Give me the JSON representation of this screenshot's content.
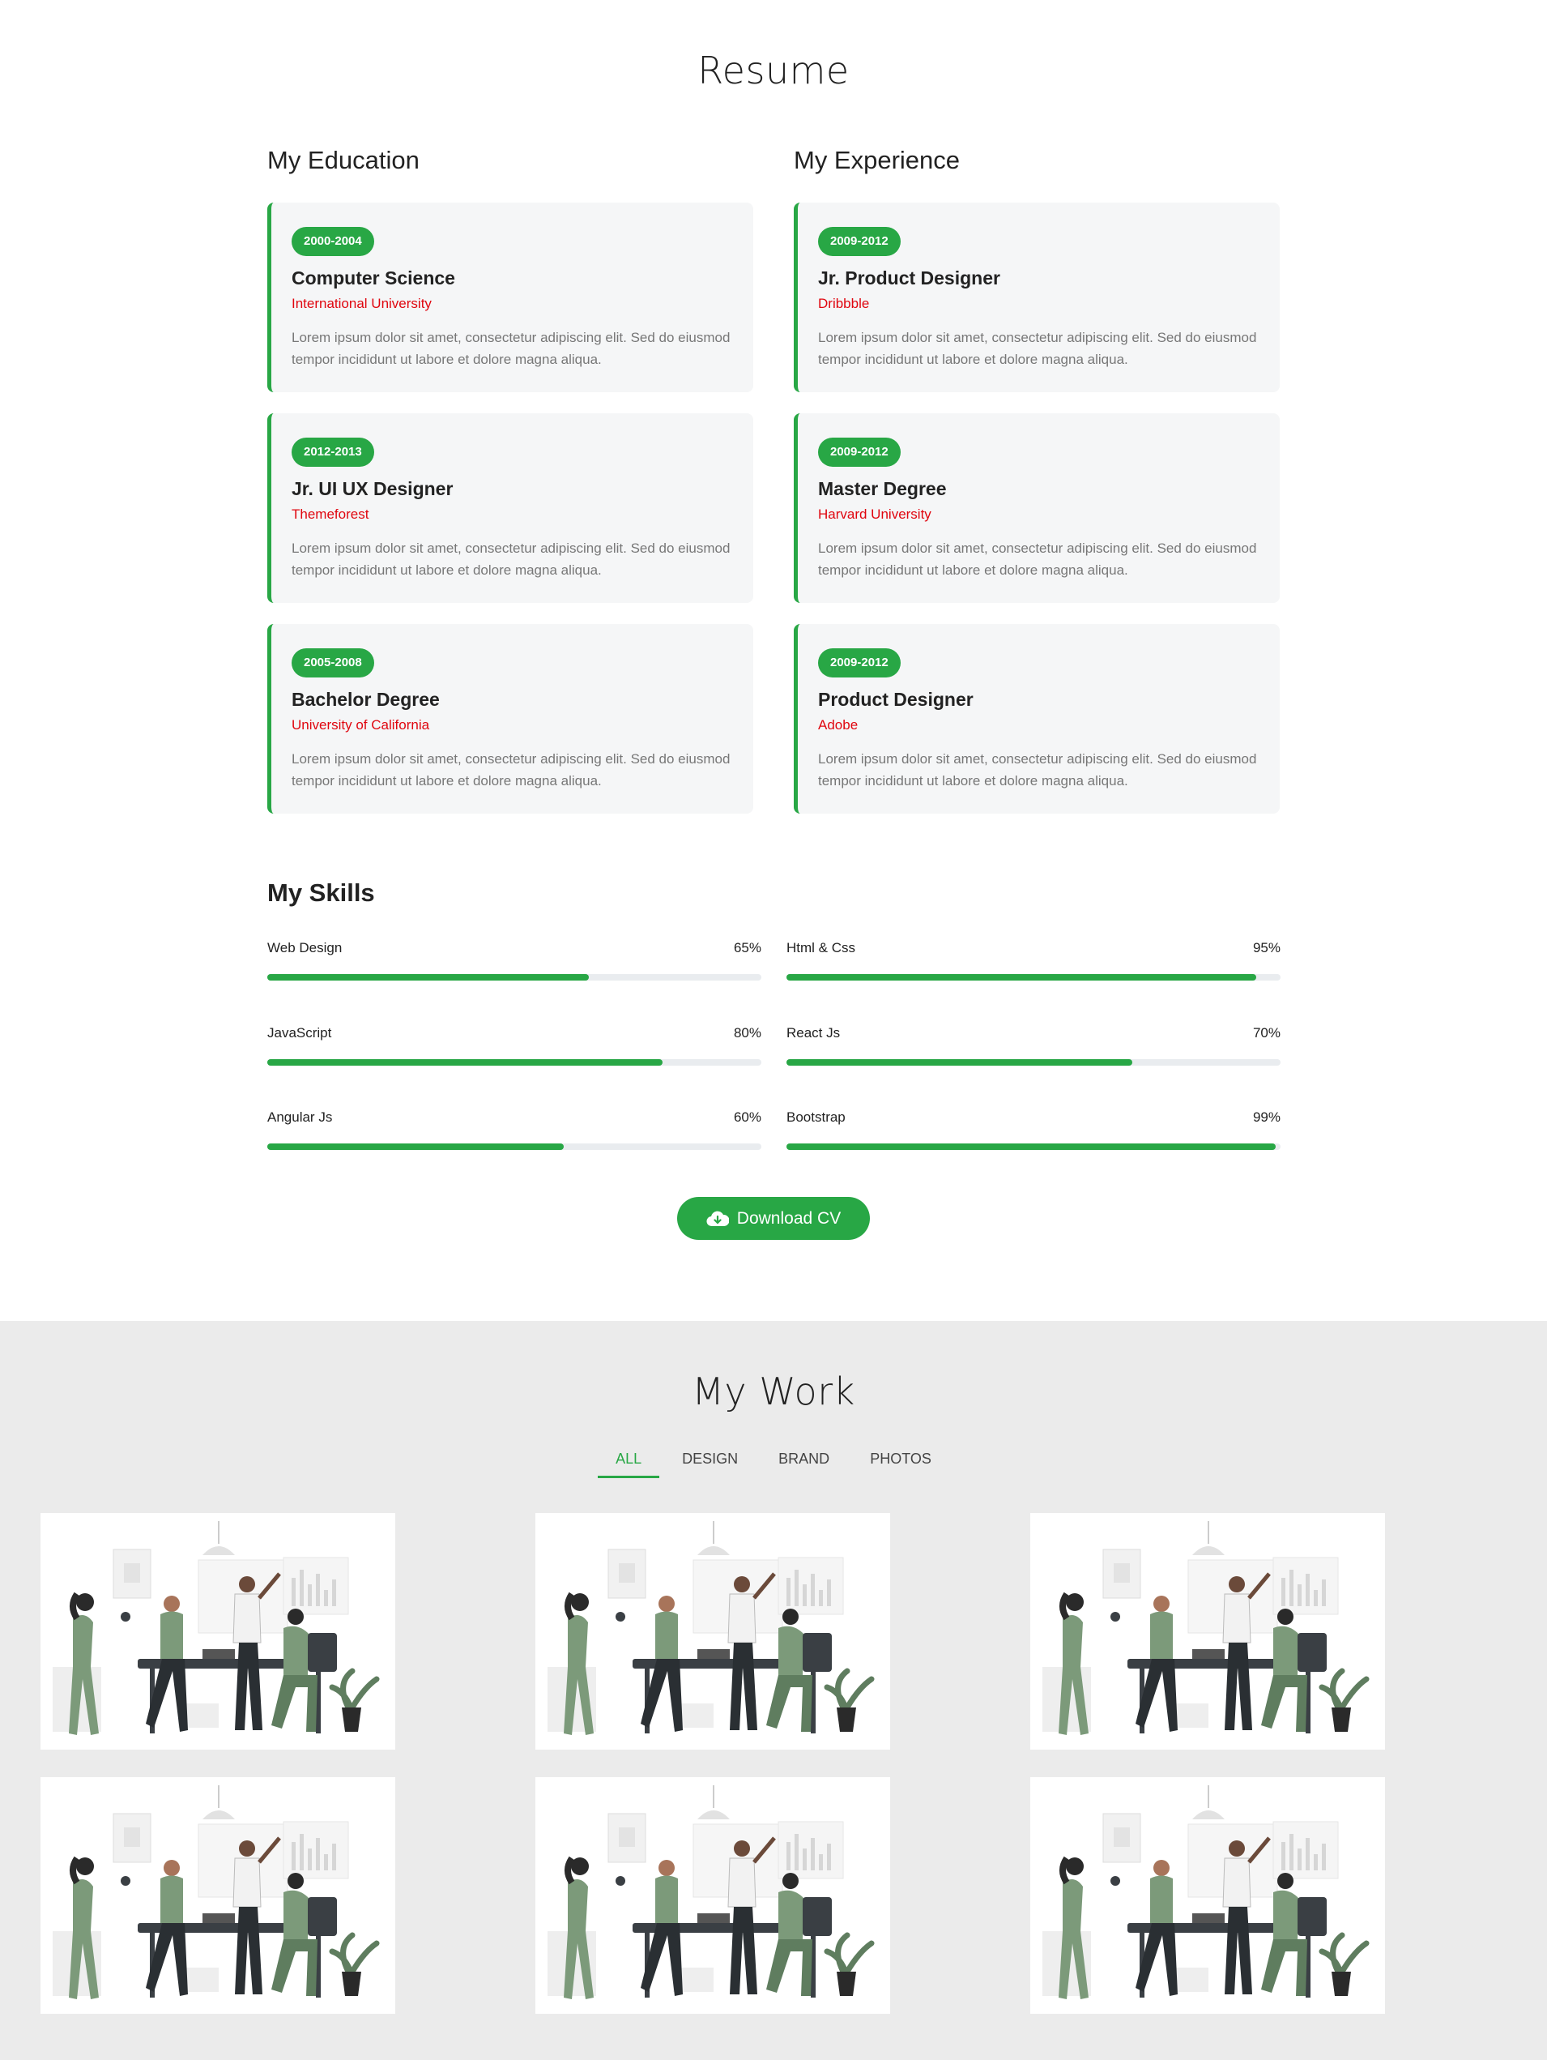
{
  "resume": {
    "title": "Resume",
    "education": {
      "heading": "My Education",
      "items": [
        {
          "years": "2000-2004",
          "title": "Computer Science",
          "org": "International University",
          "text": "Lorem ipsum dolor sit amet, consectetur adipiscing elit. Sed do eiusmod tempor incididunt ut labore et dolore magna aliqua."
        },
        {
          "years": "2012-2013",
          "title": "Jr. UI UX Designer",
          "org": "Themeforest",
          "text": "Lorem ipsum dolor sit amet, consectetur adipiscing elit. Sed do eiusmod tempor incididunt ut labore et dolore magna aliqua."
        },
        {
          "years": "2005-2008",
          "title": "Bachelor Degree",
          "org": "University of California",
          "text": "Lorem ipsum dolor sit amet, consectetur adipiscing elit. Sed do eiusmod tempor incididunt ut labore et dolore magna aliqua."
        }
      ]
    },
    "experience": {
      "heading": "My Experience",
      "items": [
        {
          "years": "2009-2012",
          "title": "Jr. Product Designer",
          "org": "Dribbble",
          "text": "Lorem ipsum dolor sit amet, consectetur adipiscing elit. Sed do eiusmod tempor incididunt ut labore et dolore magna aliqua."
        },
        {
          "years": "2009-2012",
          "title": "Master Degree",
          "org": "Harvard University",
          "text": "Lorem ipsum dolor sit amet, consectetur adipiscing elit. Sed do eiusmod tempor incididunt ut labore et dolore magna aliqua."
        },
        {
          "years": "2009-2012",
          "title": "Product Designer",
          "org": "Adobe",
          "text": "Lorem ipsum dolor sit amet, consectetur adipiscing elit. Sed do eiusmod tempor incididunt ut labore et dolore magna aliqua."
        }
      ]
    },
    "skills": {
      "heading": "My Skills",
      "items": [
        {
          "name": "Web Design",
          "percent_label": "65%",
          "value": 0.65
        },
        {
          "name": "Html & Css",
          "percent_label": "95%",
          "value": 0.95
        },
        {
          "name": "JavaScript",
          "percent_label": "80%",
          "value": 0.8
        },
        {
          "name": "React Js",
          "percent_label": "70%",
          "value": 0.7
        },
        {
          "name": "Angular Js",
          "percent_label": "60%",
          "value": 0.6
        },
        {
          "name": "Bootstrap",
          "percent_label": "99%",
          "value": 0.99
        }
      ]
    },
    "download_label": "Download CV"
  },
  "work": {
    "title": "My Work",
    "filters": [
      "ALL",
      "DESIGN",
      "BRAND",
      "PHOTOS"
    ],
    "active_filter": "ALL",
    "thumbnail_count": 6
  },
  "colors": {
    "accent": "#28a745",
    "org": "#e0060f",
    "card_bg": "#f5f6f7",
    "work_bg": "#ebebeb"
  }
}
